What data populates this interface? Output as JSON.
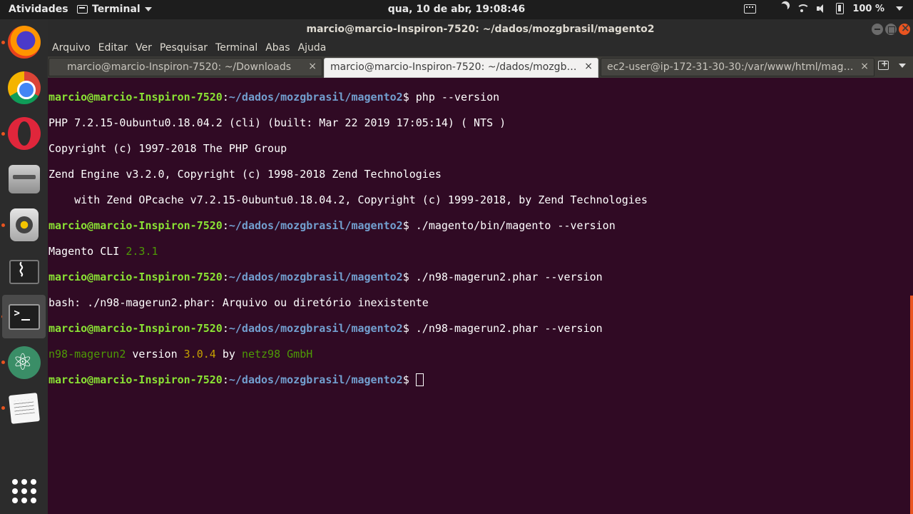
{
  "topbar": {
    "activities": "Atividades",
    "app_name": "Terminal",
    "clock": "qua, 10 de abr, 19:08:46",
    "battery": "100 %"
  },
  "dock": {
    "items": [
      {
        "name": "firefox",
        "running": true
      },
      {
        "name": "chrome",
        "running": false
      },
      {
        "name": "opera",
        "running": true
      },
      {
        "name": "files",
        "running": false
      },
      {
        "name": "rhythmbox",
        "running": true
      },
      {
        "name": "system-monitor",
        "running": false
      },
      {
        "name": "terminal",
        "running": true
      },
      {
        "name": "atom",
        "running": true
      },
      {
        "name": "text-editor",
        "running": true
      }
    ]
  },
  "window": {
    "title": "marcio@marcio-Inspiron-7520: ~/dados/mozgbrasil/magento2",
    "menu": [
      "Arquivo",
      "Editar",
      "Ver",
      "Pesquisar",
      "Terminal",
      "Abas",
      "Ajuda"
    ],
    "tabs": [
      {
        "label": "marcio@marcio-Inspiron-7520: ~/Downloads",
        "active": false
      },
      {
        "label": "marcio@marcio-Inspiron-7520: ~/dados/mozgbra...",
        "active": true
      },
      {
        "label": "ec2-user@ip-172-31-30-30:/var/www/html/magento",
        "active": false
      }
    ],
    "tab_close": "×"
  },
  "terminal": {
    "prompt_user": "marcio@marcio-Inspiron-7520",
    "prompt_path": "~/dados/mozgbrasil/magento2",
    "colon": ":",
    "dollar": "$ ",
    "cmd1": "php --version",
    "out1_1": "PHP 7.2.15-0ubuntu0.18.04.2 (cli) (built: Mar 22 2019 17:05:14) ( NTS )",
    "out1_2": "Copyright (c) 1997-2018 The PHP Group",
    "out1_3": "Zend Engine v3.2.0, Copyright (c) 1998-2018 Zend Technologies",
    "out1_4": "    with Zend OPcache v7.2.15-0ubuntu0.18.04.2, Copyright (c) 1999-2018, by Zend Technologies",
    "cmd2": "./magento/bin/magento --version",
    "out2_a": "Magento CLI ",
    "out2_b": "2.3.1",
    "cmd3": "./n98-magerun2.phar --version",
    "out3": "bash: ./n98-magerun2.phar: Arquivo ou diretório inexistente",
    "cmd4": "./n98-magerun2.phar --version",
    "out4_a": "n98-magerun2",
    "out4_b": " version ",
    "out4_c": "3.0.4",
    "out4_d": " by ",
    "out4_e": "netz98 GmbH"
  }
}
